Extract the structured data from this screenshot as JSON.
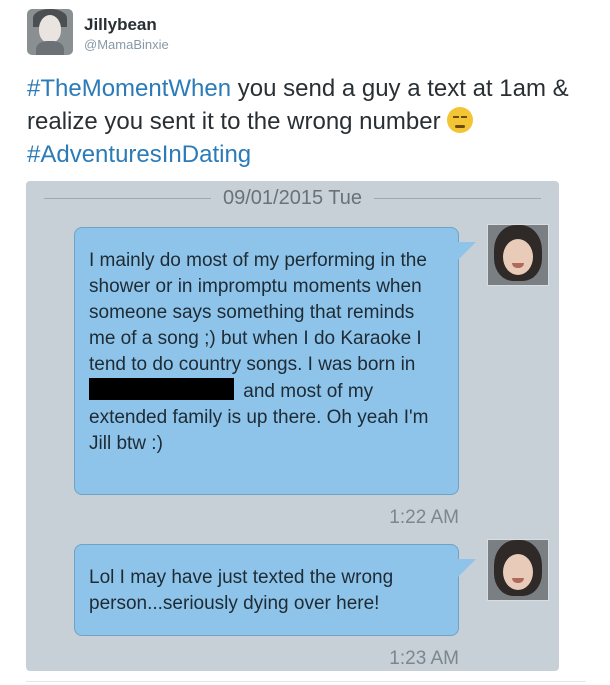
{
  "user": {
    "display_name": "Jillybean",
    "handle": "@MamaBinxie"
  },
  "tweet": {
    "hashtag1": "#TheMomentWhen",
    "text": " you send a guy a text at 1am & realize you sent it to the wrong number ",
    "emoji": "unamused-face",
    "hashtag2": "#AdventuresInDating"
  },
  "screenshot": {
    "date": "09/01/2015 Tue",
    "messages": [
      {
        "text_before": "I mainly do most of my performing in the shower or in impromptu moments when someone says something that reminds me of a song ;) but when I do Karaoke I tend to do country songs.  I was born in",
        "redacted": true,
        "text_after": "and most of my extended family is up there.  Oh yeah I'm Jill btw :)",
        "time": "1:22 AM"
      },
      {
        "text": "Lol I may have just texted the wrong person...seriously dying over here!",
        "time": "1:23 AM"
      }
    ]
  },
  "colors": {
    "hashtag": "#2b7bb9",
    "bubble": "#8ec4e9",
    "screen_bg": "#c8d0d7"
  }
}
